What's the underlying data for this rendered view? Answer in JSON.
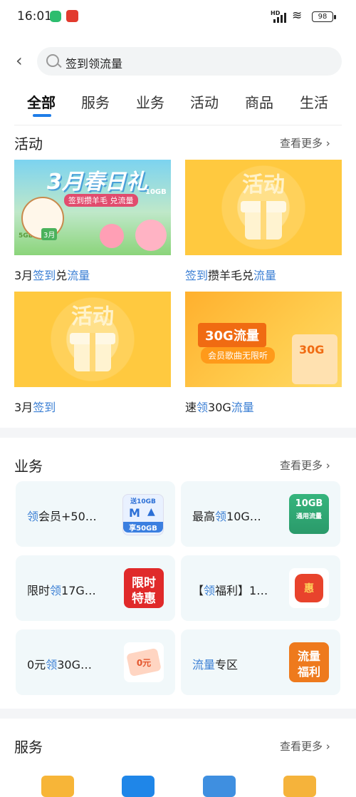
{
  "status": {
    "time": "16:01",
    "hd": "HD",
    "battery": "98"
  },
  "search": {
    "query": "签到领流量"
  },
  "tabs": [
    "全部",
    "服务",
    "业务",
    "活动",
    "商品",
    "生活"
  ],
  "activity": {
    "title": "活动",
    "more": "查看更多 ›",
    "cards": [
      {
        "pre": "3月",
        "h1": "签到",
        "mid": "兑",
        "h2": "流量",
        "post": "",
        "art": {
          "title": "3月春日礼",
          "sub": "签到攒羊毛 兑流量",
          "badge": "10GB",
          "side": "5GB",
          "month": "3月"
        }
      },
      {
        "pre": "",
        "h1": "签到",
        "mid": "攒羊毛兑",
        "h2": "流量",
        "post": "",
        "art": {
          "label": "活动"
        }
      },
      {
        "pre": "3月",
        "h1": "签到",
        "mid": "",
        "h2": "",
        "post": "",
        "art": {
          "label": "活动"
        }
      },
      {
        "pre": "速",
        "h1": "领",
        "mid": "30G",
        "h2": "流量",
        "post": "",
        "art": {
          "banner": "30G流量",
          "sub": "会员歌曲无限听",
          "tag": "30G"
        }
      }
    ]
  },
  "business": {
    "title": "业务",
    "more": "查看更多 ›",
    "items": [
      {
        "pre": "",
        "hl": "领",
        "post": "会员+50…",
        "icon": "member-50gb-icon",
        "icon_top": "送10GB",
        "icon_bottom": "享50GB"
      },
      {
        "pre": "最高",
        "hl": "领",
        "post": "10G…",
        "icon": "10gb-flow-icon",
        "icon_top": "10GB",
        "icon_bottom": "通用流量"
      },
      {
        "pre": "限时",
        "hl": "领",
        "post": "17G…",
        "icon": "limited-offer-icon",
        "icon_top": "限时",
        "icon_bottom": "特惠"
      },
      {
        "pre": "【",
        "hl": "领",
        "post": "福利】1…",
        "icon": "red-bag-icon",
        "icon_top": "惠",
        "icon_bottom": ""
      },
      {
        "pre": "0元",
        "hl": "领",
        "post": "30G…",
        "icon": "coupon-icon",
        "icon_top": "0元",
        "icon_bottom": ""
      },
      {
        "pre": "",
        "hl": "流量",
        "post": "专区",
        "icon": "flow-welfare-icon",
        "icon_top": "流量",
        "icon_bottom": "福利"
      }
    ]
  },
  "service": {
    "title": "服务",
    "more": "查看更多 ›"
  },
  "colors": {
    "accent": "#1f7de8",
    "highlight": "#3b7fd4",
    "card_bg": "#f1f8fa"
  }
}
